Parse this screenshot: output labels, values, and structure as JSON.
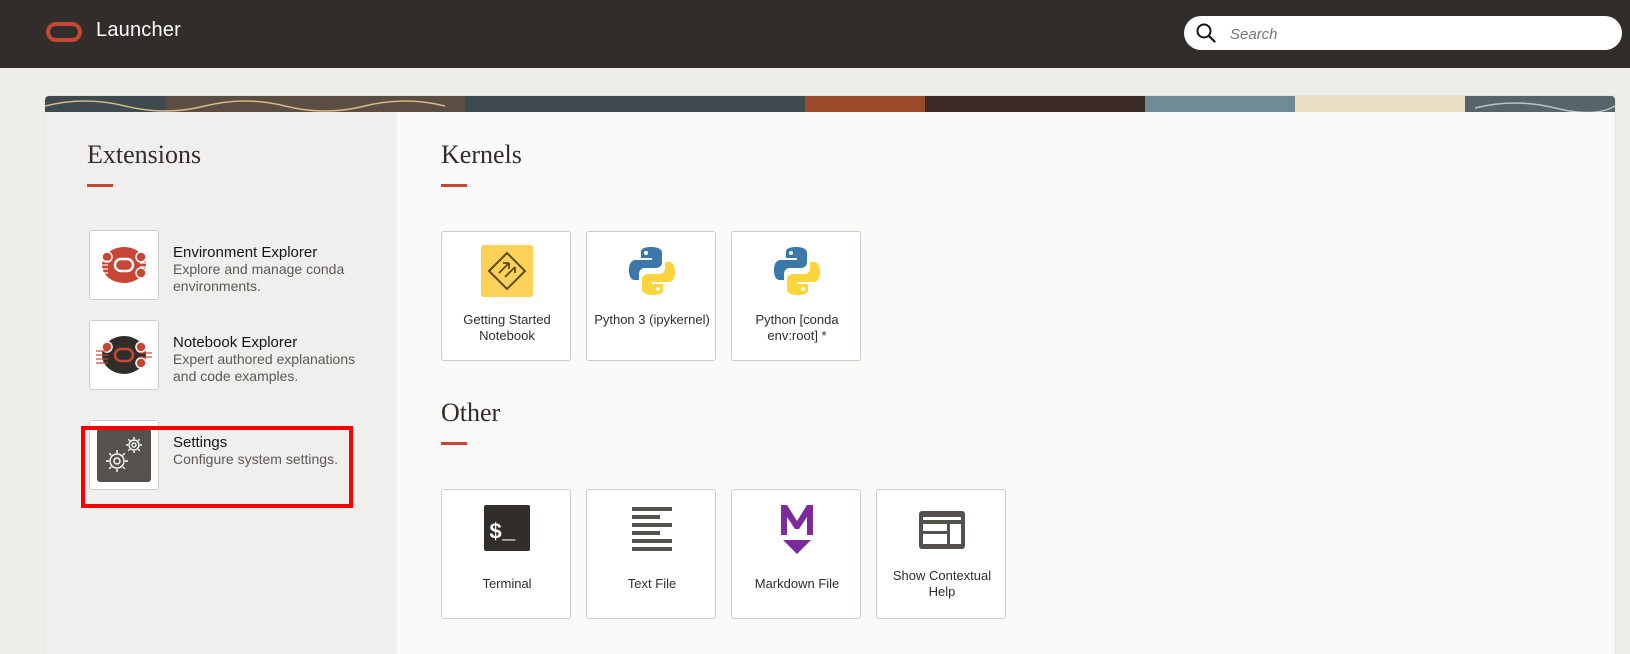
{
  "header": {
    "title": "Launcher",
    "logo_icon": "oracle-logo",
    "search": {
      "placeholder": "Search",
      "value": ""
    }
  },
  "extensions": {
    "heading": "Extensions",
    "items": [
      {
        "title": "Environment Explorer",
        "description": "Explore and manage conda environments.",
        "icon": "environment-explorer-icon"
      },
      {
        "title": "Notebook Explorer",
        "description": "Expert authored explanations and code examples.",
        "icon": "notebook-explorer-icon"
      },
      {
        "title": "Settings",
        "description": "Configure system settings.",
        "icon": "gears-icon",
        "highlighted": true
      }
    ]
  },
  "kernels": {
    "heading": "Kernels",
    "tiles": [
      {
        "label": "Getting Started Notebook",
        "icon": "getting-started-icon"
      },
      {
        "label": "Python 3 (ipykernel)",
        "icon": "python-logo-icon"
      },
      {
        "label": "Python [conda env:root] *",
        "icon": "python-logo-icon"
      }
    ]
  },
  "other": {
    "heading": "Other",
    "tiles": [
      {
        "label": "Terminal",
        "icon": "terminal-icon",
        "glyph": "$_"
      },
      {
        "label": "Text File",
        "icon": "text-file-icon"
      },
      {
        "label": "Markdown File",
        "icon": "markdown-icon"
      },
      {
        "label": "Show Contextual Help",
        "icon": "contextual-help-icon"
      }
    ]
  },
  "colors": {
    "topbar": "#312d2a",
    "accent": "#c74634",
    "highlight": "#f80000",
    "markdown": "#7b2b9b"
  }
}
